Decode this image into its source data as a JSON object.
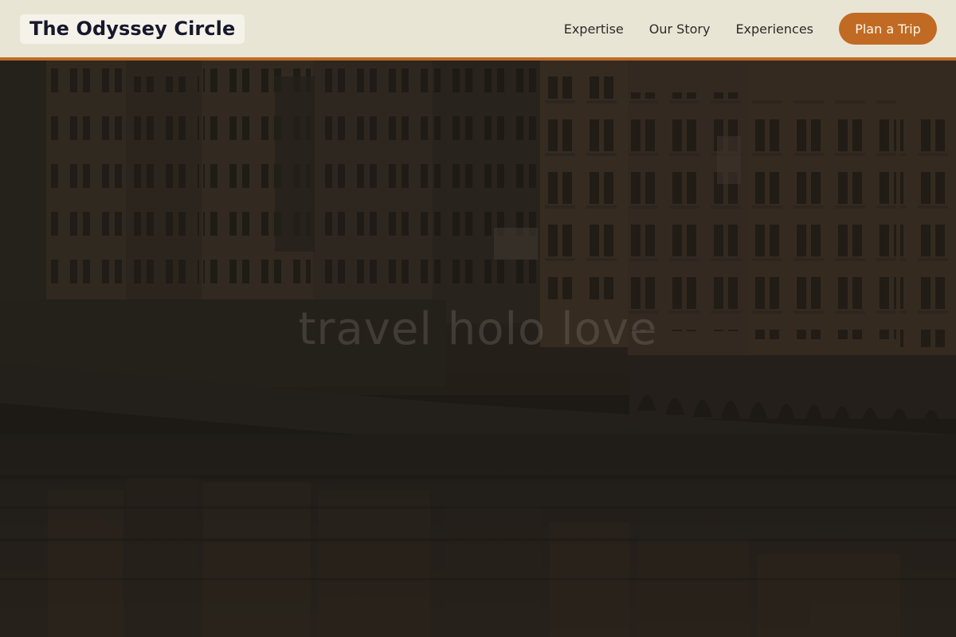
{
  "brand": {
    "name": "The Odyssey Circle"
  },
  "nav": {
    "links": [
      "Expertise",
      "Our Story",
      "Experiences"
    ],
    "cta_label": "Plan a Trip"
  },
  "hero": {
    "tagline": "travel holo love"
  },
  "colors": {
    "header_bg": "#e9e5d4",
    "accent": "#c06a24",
    "brand_text": "#16182b",
    "hero_overlay": "#1f1c18"
  }
}
